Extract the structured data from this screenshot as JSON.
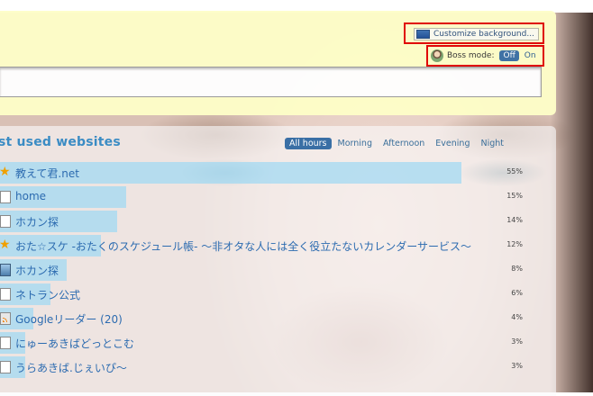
{
  "header": {
    "customize_label": "Customize background...",
    "boss_mode_label": "Boss mode:",
    "boss_off": "Off",
    "boss_on": "On",
    "search_value": ""
  },
  "main": {
    "title": "st used websites",
    "tabs": [
      {
        "label": "All hours",
        "active": true
      },
      {
        "label": "Morning",
        "active": false
      },
      {
        "label": "Afternoon",
        "active": false
      },
      {
        "label": "Evening",
        "active": false
      },
      {
        "label": "Night",
        "active": false
      }
    ],
    "sites": [
      {
        "name": "教えて君.net",
        "pct": "55%",
        "share": 0.55,
        "icon": "star-icon"
      },
      {
        "name": "home",
        "pct": "15%",
        "share": 0.15,
        "icon": "page-icon"
      },
      {
        "name": "ホカン探",
        "pct": "14%",
        "share": 0.14,
        "icon": "page-icon"
      },
      {
        "name": "おた☆スケ -おたくのスケジュール帳- ～非オタな人には全く役立たないカレンダーサービス～",
        "pct": "12%",
        "share": 0.12,
        "icon": "star-icon"
      },
      {
        "name": "ホカン探",
        "pct": "8%",
        "share": 0.08,
        "icon": "image-icon"
      },
      {
        "name": "ネトラン公式",
        "pct": "6%",
        "share": 0.06,
        "icon": "page-icon"
      },
      {
        "name": "Googleリーダー (20)",
        "pct": "4%",
        "share": 0.04,
        "icon": "rss-icon"
      },
      {
        "name": "にゅーあきばどっとこむ",
        "pct": "3%",
        "share": 0.03,
        "icon": "page-icon"
      },
      {
        "name": "うらあきば.じぇいぴ～",
        "pct": "3%",
        "share": 0.03,
        "icon": "page-icon"
      }
    ]
  }
}
